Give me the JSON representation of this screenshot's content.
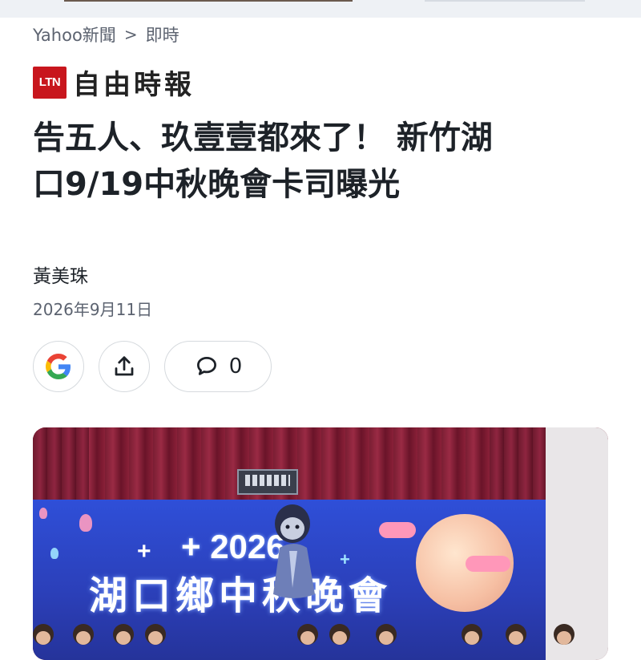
{
  "breadcrumb": {
    "site": "Yahoo新聞",
    "separator": ">",
    "section": "即時"
  },
  "source": {
    "badge": "LTN",
    "name": "自由時報",
    "badge_color": "#c8161d"
  },
  "article": {
    "headline_line1": "告五人、玖壹壹都來了！ 新竹湖",
    "headline_line2": "口9/19中秋晚會卡司曝光",
    "author": "黃美珠",
    "date": "2026年9月11日"
  },
  "actions": {
    "google_icon": "google-icon",
    "share_icon": "share-icon",
    "comment_icon": "comment-icon",
    "comment_count": "0"
  },
  "photo": {
    "banner_year": "+ 2026",
    "banner_title": "湖口鄉中秋晚會"
  }
}
